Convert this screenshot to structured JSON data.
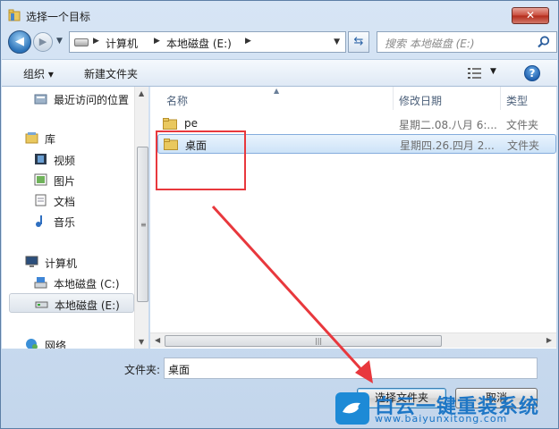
{
  "window": {
    "title": "选择一个目标",
    "close_label": "✕"
  },
  "address": {
    "crumbs": [
      "计算机",
      "本地磁盘 (E:)"
    ],
    "search_placeholder": "搜索 本地磁盘 (E:)"
  },
  "toolbar": {
    "organize_label": "组织 ▾",
    "new_folder_label": "新建文件夹",
    "help_label": "?"
  },
  "nav_pane": {
    "items": [
      {
        "label": "最近访问的位置",
        "icon": "recent-places-icon"
      },
      {
        "label": "库",
        "icon": "library-icon"
      },
      {
        "label": "视频",
        "icon": "video-icon"
      },
      {
        "label": "图片",
        "icon": "pictures-icon"
      },
      {
        "label": "文档",
        "icon": "documents-icon"
      },
      {
        "label": "音乐",
        "icon": "music-icon"
      },
      {
        "label": "计算机",
        "icon": "computer-icon"
      },
      {
        "label": "本地磁盘 (C:)",
        "icon": "system-drive-icon"
      },
      {
        "label": "本地磁盘 (E:)",
        "icon": "drive-icon",
        "selected": true
      },
      {
        "label": "网络",
        "icon": "network-icon"
      }
    ]
  },
  "file_pane": {
    "columns": [
      "名称",
      "修改日期",
      "类型"
    ],
    "rows": [
      {
        "name": "pe",
        "date": "星期二.08.八月 6:...",
        "type": "文件夹"
      },
      {
        "name": "桌面",
        "date": "星期四.26.四月 2...",
        "type": "文件夹",
        "selected": true
      }
    ]
  },
  "bottom": {
    "folder_label": "文件夹:",
    "folder_value": "桌面",
    "select_button": "选择文件夹",
    "cancel_button": "取消"
  },
  "watermark": {
    "text": "白云一键重装系统",
    "url": "www.baiyunxitong.com"
  },
  "colors": {
    "annotation": "#e8383d",
    "accent": "#1672c4"
  }
}
